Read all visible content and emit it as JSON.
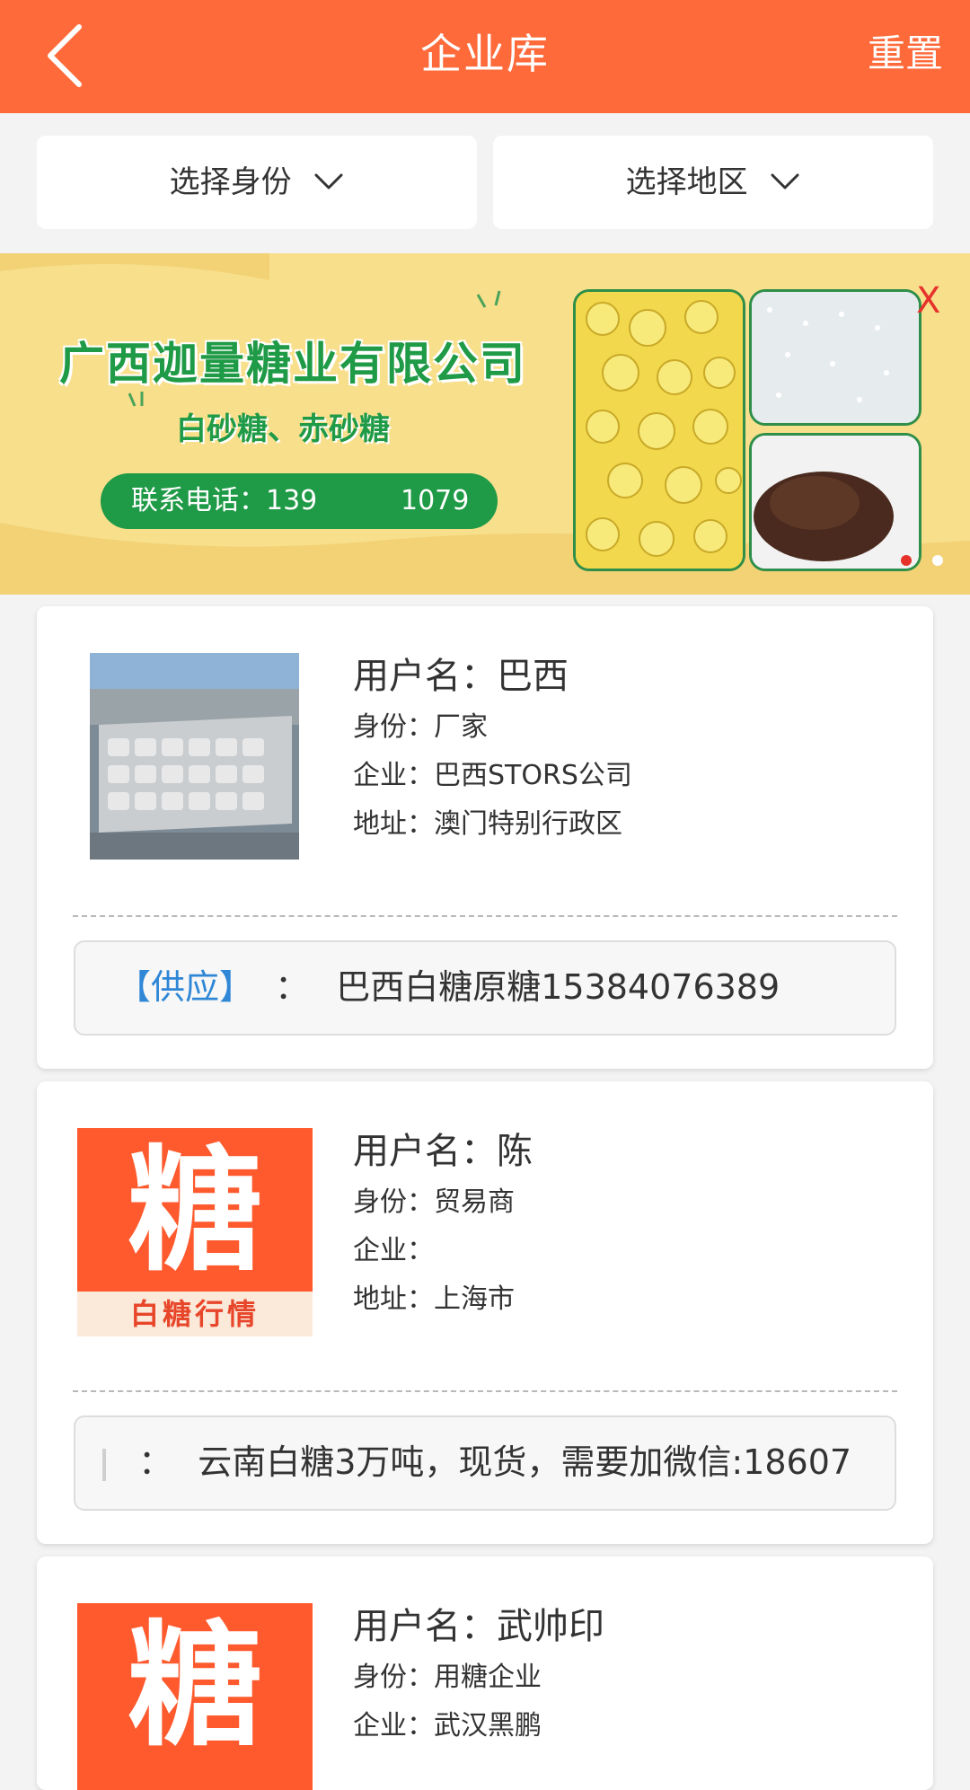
{
  "header": {
    "title": "企业库",
    "reset_label": "重置"
  },
  "filters": {
    "identity": "选择身份",
    "region": "选择地区"
  },
  "banner": {
    "company": "广西迦量糖业有限公司",
    "products": "白砂糖、赤砂糖",
    "phone_label": "联系电话：139",
    "phone_tail": "1079",
    "close": "X"
  },
  "labels": {
    "username": "用户名：",
    "identity": "身份：",
    "company": "企业：",
    "address": "地址："
  },
  "cards": [
    {
      "username": "巴西",
      "identity": "厂家",
      "company": "巴西STORS公司",
      "address": "澳门特别行政区",
      "supply_tag": "【供应】",
      "supply_sep": "：",
      "supply_text": "巴西白糖原糖15384076389"
    },
    {
      "username": "陈",
      "identity": "贸易商",
      "company": "",
      "address": "上海市",
      "supply_tag": "",
      "supply_sep": "：",
      "supply_text": "云南白糖3万吨，现货，需要加微信:18607"
    },
    {
      "username": "武帅印",
      "identity": "用糖企业",
      "company": "武汉黑鹏"
    }
  ],
  "logo": {
    "big": "糖",
    "small": "白糖行情"
  },
  "colors": {
    "accent": "#ff6a3a",
    "green": "#1f9a46",
    "tag_blue": "#2f87d6"
  }
}
